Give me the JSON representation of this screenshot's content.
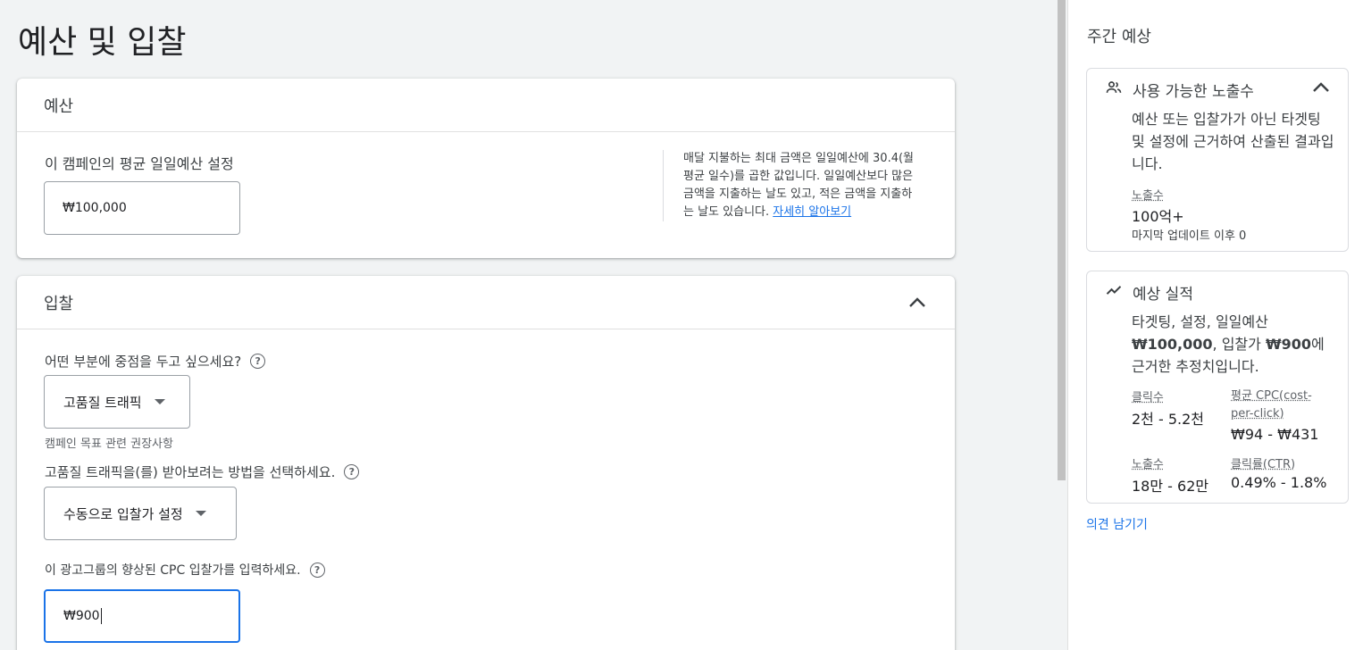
{
  "page": {
    "title": "예산 및 입찰"
  },
  "budget": {
    "header": "예산",
    "label": "이 캠페인의 평균 일일예산 설정",
    "value": "₩100,000",
    "note": "매달 지불하는 최대 금액은 일일예산에 30.4(월 평균 일수)를 곱한 값입니다. 일일예산보다 많은 금액을 지출하는 날도 있고, 적은 금액을 지출하는 날도 있습니다.",
    "learn_more": "자세히 알아보기"
  },
  "bidding": {
    "header": "입찰",
    "focus_question": "어떤 부분에 중점을 두고 싶으세요?",
    "focus_value": "고품질 트래픽",
    "recommendation_hint": "캠페인 목표 관련 권장사항",
    "method_question": "고품질 트래픽을(를) 받아보려는 방법을 선택하세요.",
    "method_value": "수동으로 입찰가 설정",
    "cpc_question": "이 광고그룹의 향상된 CPC 입찰가를 입력하세요.",
    "cpc_value": "₩900"
  },
  "sidebar": {
    "title": "주간 예상",
    "reach": {
      "title": "사용 가능한 노출수",
      "description": "예산 또는 입찰가가 아닌 타겟팅 및 설정에 근거하여 산출된 결과입니다.",
      "impressions_label": "노출수",
      "impressions_value": "100억+",
      "updated": "마지막 업데이트 이후 0"
    },
    "performance": {
      "title": "예상 실적",
      "description_prefix": "타겟팅, 설정, 일일예산 ",
      "budget_bold": "₩100,000",
      "description_mid": ", 입찰가 ",
      "bid_bold": "₩900",
      "description_suffix": "에 근거한 추정치입니다.",
      "clicks_label": "클릭수",
      "clicks_value": "2천 - 5.2천",
      "avg_cpc_label": "평균 CPC(cost-per-click)",
      "avg_cpc_value": "₩94 - ₩431",
      "impressions_label": "노출수",
      "impressions_value": "18만 - 62만",
      "ctr_label": "클릭률(CTR)",
      "ctr_value": "0.49% - 1.8%"
    },
    "feedback": "의견 남기기"
  },
  "icons": {
    "help": "help-circle-icon",
    "chevron": "chevron-up-icon",
    "people": "people-icon",
    "trend": "trending-up-icon",
    "caret": "dropdown-caret-icon"
  }
}
